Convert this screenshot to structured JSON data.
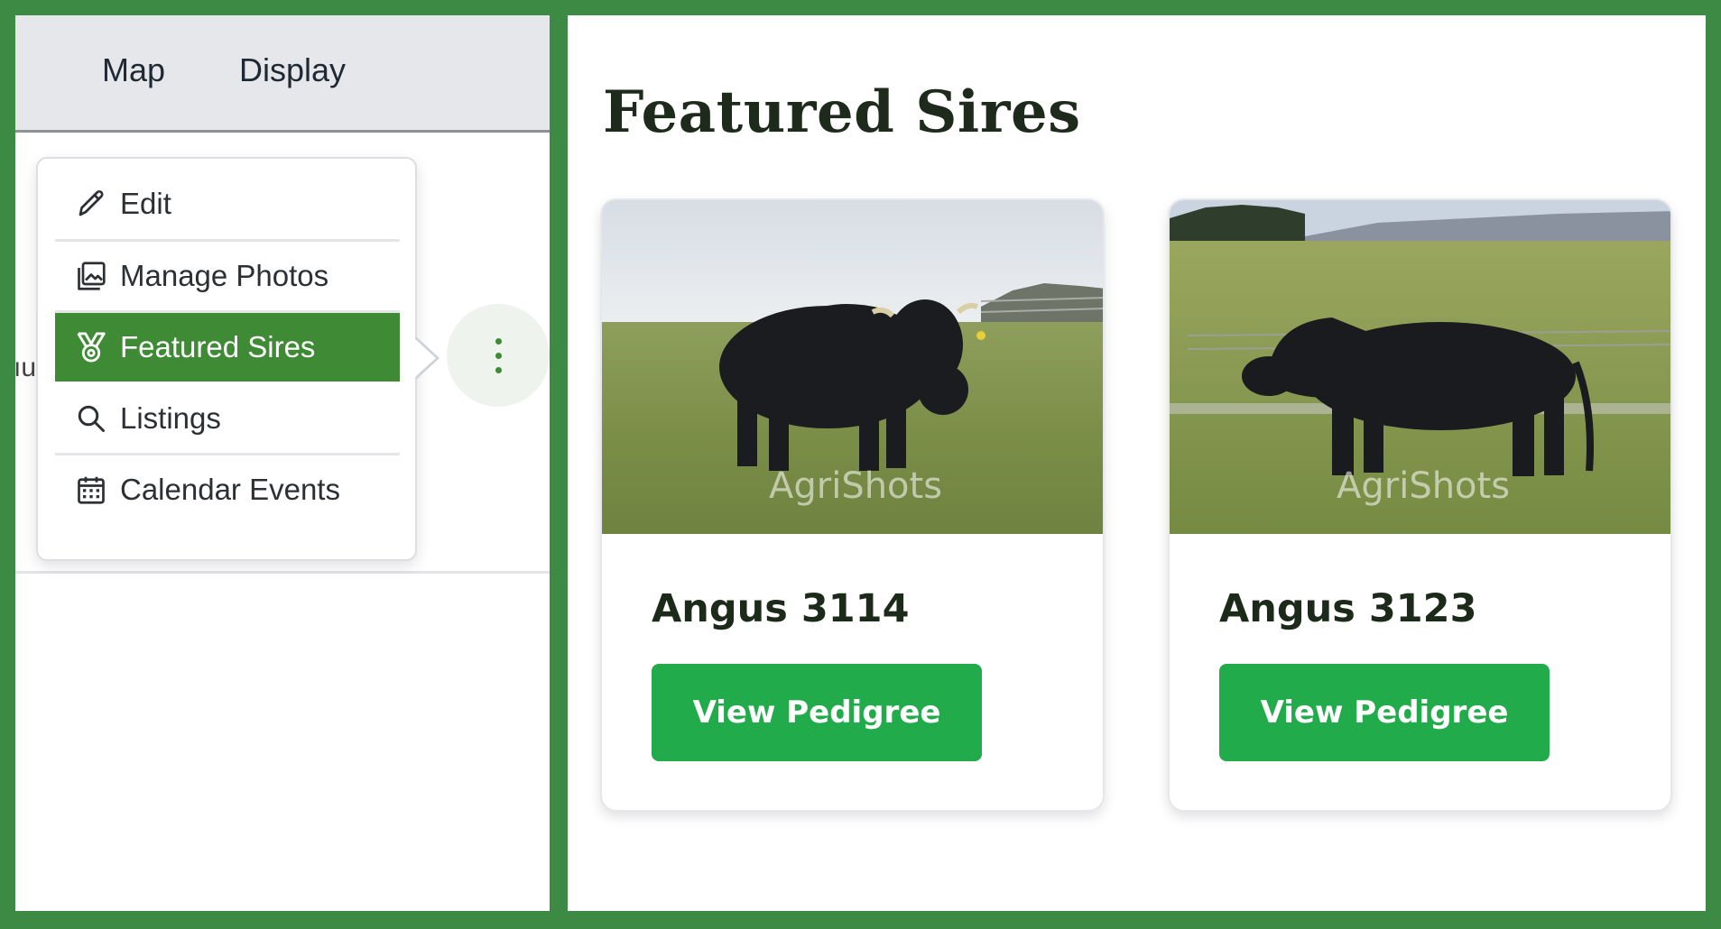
{
  "tabs": {
    "map": "Map",
    "display": "Display"
  },
  "edge_text": "ıu",
  "menu": {
    "items": [
      {
        "label": "Edit",
        "icon": "pencil-icon"
      },
      {
        "label": "Manage Photos",
        "icon": "photos-icon"
      },
      {
        "label": "Featured Sires",
        "icon": "award-ribbon-icon",
        "active": true
      },
      {
        "label": "Listings",
        "icon": "search-icon"
      },
      {
        "label": "Calendar Events",
        "icon": "calendar-icon"
      }
    ]
  },
  "section": {
    "title": "Featured Sires"
  },
  "sires": [
    {
      "name": "Angus 3114",
      "button": "View Pedigree",
      "watermark": "AgriShots"
    },
    {
      "name": "Angus 3123",
      "button": "View Pedigree",
      "watermark": "AgriShots"
    }
  ],
  "colors": {
    "frame": "#3c8a43",
    "menu_active": "#3f8b35",
    "button": "#22ab4a",
    "title": "#1e2a1c"
  }
}
